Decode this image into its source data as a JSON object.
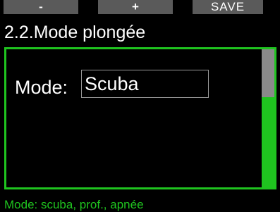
{
  "softkeys": {
    "minus_label": "-",
    "plus_label": "+",
    "save_label": "SAVE"
  },
  "title": "2.2.Mode plongée",
  "setting": {
    "label": "Mode:",
    "value": "Scuba"
  },
  "scrollbar": {
    "position_fraction": 0.35
  },
  "help_text": "Mode: scuba, prof., apnée",
  "colors": {
    "accent": "#1fc41f",
    "softkey_bg": "#5a5a5a",
    "background": "#000000"
  }
}
